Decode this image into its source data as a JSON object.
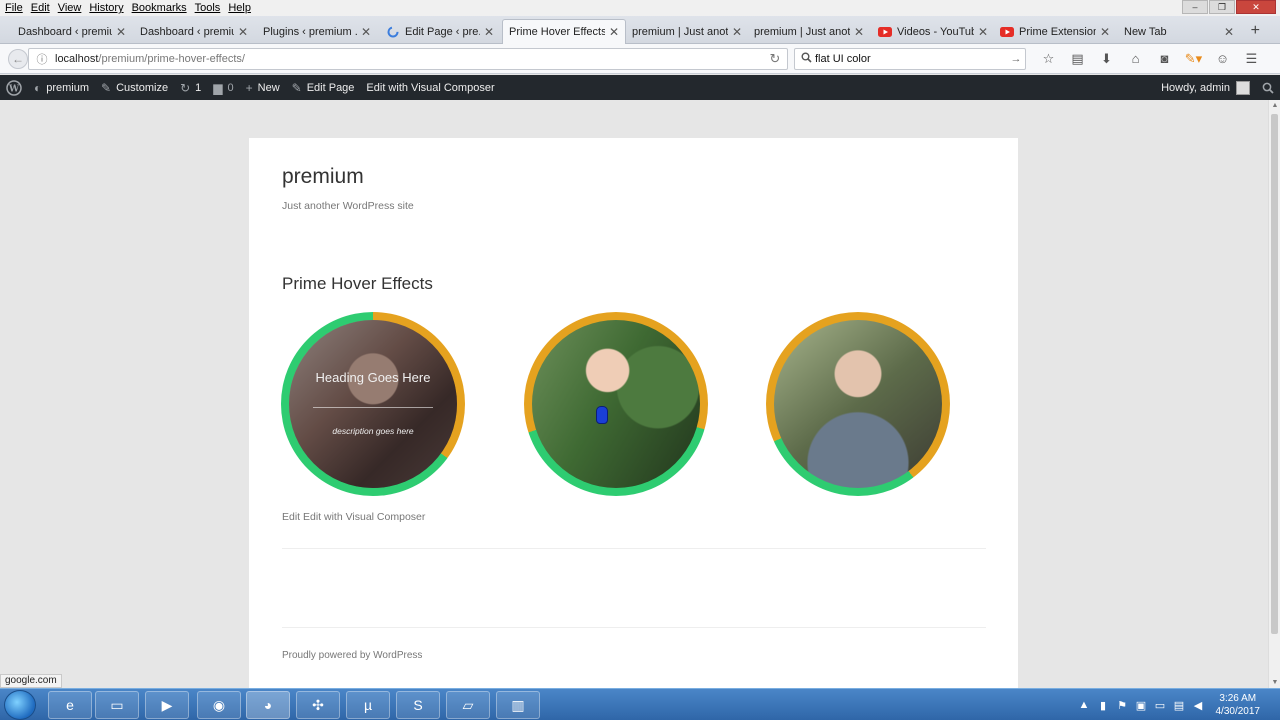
{
  "menubar": {
    "items": [
      "File",
      "Edit",
      "View",
      "History",
      "Bookmarks",
      "Tools",
      "Help"
    ]
  },
  "tabs": [
    {
      "label": "Dashboard ‹ premiu...",
      "icon": "wordpress-icon"
    },
    {
      "label": "Dashboard ‹ premiu...",
      "icon": "wordpress-icon"
    },
    {
      "label": "Plugins ‹ premium ...",
      "icon": "wordpress-icon"
    },
    {
      "label": "Edit Page ‹ pre...",
      "icon": "loading-spinner-icon"
    },
    {
      "label": "Prime Hover Effects ...",
      "icon": "none",
      "active": true
    },
    {
      "label": "premium | Just anot...",
      "icon": "none"
    },
    {
      "label": "premium | Just anot...",
      "icon": "none"
    },
    {
      "label": "Videos - YouTube",
      "icon": "youtube-icon"
    },
    {
      "label": "Prime Extension...",
      "icon": "youtube-icon"
    },
    {
      "label": "New Tab",
      "icon": "none"
    }
  ],
  "navbar": {
    "url_host": "localhost",
    "url_path": "/premium/prime-hover-effects/",
    "search_value": "flat UI color"
  },
  "adminbar": {
    "site_name": "premium",
    "customize": "Customize",
    "updates_count": "1",
    "comments_count": "0",
    "new_label": "New",
    "edit_page": "Edit Page",
    "edit_vc": "Edit with Visual Composer",
    "howdy": "Howdy, admin"
  },
  "page": {
    "site_title": "premium",
    "site_description": "Just another WordPress site",
    "entry_title": "Prime Hover Effects",
    "hover_heading": "Heading Goes Here",
    "hover_description": "description goes here",
    "edit_links": "Edit Edit with Visual Composer",
    "footer": "Proudly powered by WordPress"
  },
  "status_text": "google.com",
  "clock": {
    "time": "3:26 AM",
    "date": "4/30/2017"
  },
  "colors": {
    "ring_orange": "#e5a21f",
    "ring_green": "#2ecc71",
    "adminbar_bg": "#23282d"
  }
}
